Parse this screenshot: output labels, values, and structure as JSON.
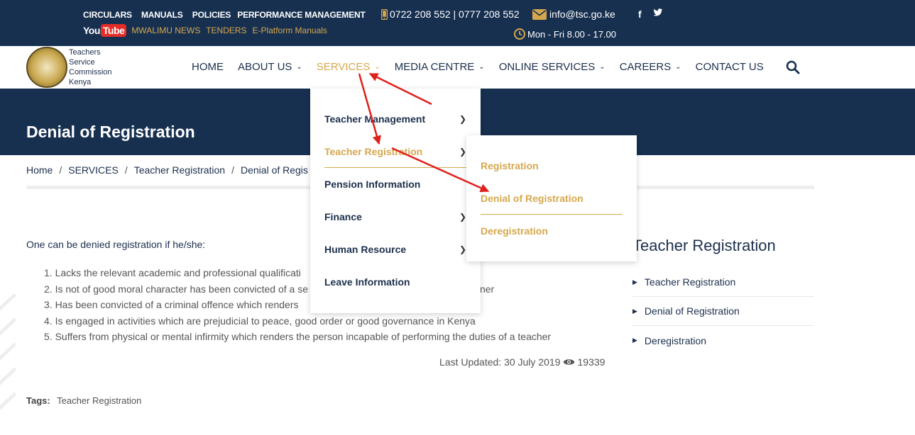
{
  "topbar": {
    "links": [
      "CIRCULARS",
      "MANUALS",
      "POLICIES",
      "PERFORMANCE MANAGEMENT"
    ],
    "youtube_you": "You",
    "youtube_tube": "Tube",
    "sublinks": [
      "MWALIMU NEWS",
      "TENDERS",
      "E-Platform Manuals"
    ],
    "phone": "0722 208 552 | 0777 208 552",
    "email": "info@tsc.go.ke",
    "hours": "Mon - Fri 8.00 - 17.00",
    "social": [
      "f",
      "twitter"
    ]
  },
  "logo": {
    "lines": [
      "Teachers",
      "Service",
      "Commission",
      "Kenya"
    ]
  },
  "nav": {
    "items": [
      {
        "label": "HOME",
        "has_chevron": false
      },
      {
        "label": "ABOUT US",
        "has_chevron": true
      },
      {
        "label": "SERVICES",
        "has_chevron": true,
        "active": true
      },
      {
        "label": "MEDIA CENTRE",
        "has_chevron": true
      },
      {
        "label": "ONLINE SERVICES",
        "has_chevron": true
      },
      {
        "label": "CAREERS",
        "has_chevron": true
      },
      {
        "label": "CONTACT US",
        "has_chevron": false
      }
    ]
  },
  "hero": {
    "title": "Denial of Registration"
  },
  "breadcrumb": [
    "Home",
    "SERVICES",
    "Teacher Registration",
    "Denial of Regis"
  ],
  "content": {
    "lead": "One can be denied registration if he/she:",
    "requirements": [
      "1. Lacks the relevant academic and professional qualificati",
      "2. Is not of good moral character has been convicted of a se                                                         earner",
      "3. Has been convicted of a criminal offence which renders",
      "4. Is engaged in activities which are prejudicial to peace, good order or good governance in Kenya",
      "5. Suffers from physical or mental infirmity which renders the person incapable of performing the duties of a teacher"
    ],
    "updated": "Last Updated: 30 July 2019",
    "views": "19339",
    "tags_label": "Tags:",
    "tags": "Teacher Registration"
  },
  "sidebar": {
    "title": "Teacher Registration",
    "items": [
      "Teacher Registration",
      "Denial of Registration",
      "Deregistration"
    ]
  },
  "dropdown": {
    "items": [
      {
        "label": "Teacher Management",
        "has_arrow": true
      },
      {
        "label": "Teacher Registration",
        "has_arrow": true,
        "active": true
      },
      {
        "label": "Pension Information",
        "has_arrow": false
      },
      {
        "label": "Finance",
        "has_arrow": true
      },
      {
        "label": "Human Resource",
        "has_arrow": true
      },
      {
        "label": "Leave Information",
        "has_arrow": false
      }
    ],
    "submenu": [
      {
        "label": "Registration"
      },
      {
        "label": "Denial of Registration",
        "active": true
      },
      {
        "label": "Deregistration"
      }
    ]
  },
  "colors": {
    "navy": "#173050",
    "gold": "#d6a84d",
    "text": "#1c2f4d",
    "annotation": "#e0201b"
  }
}
